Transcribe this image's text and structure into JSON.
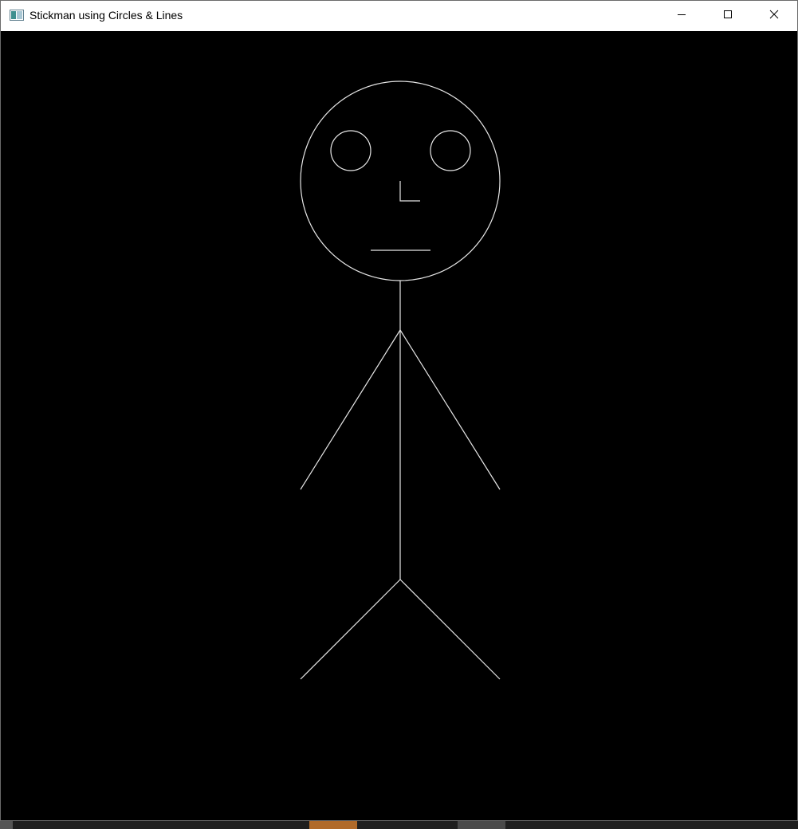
{
  "window": {
    "title": "Stickman using Circles & Lines",
    "app_icon": "app-window-icon",
    "controls": {
      "minimize_icon": "minimize-icon",
      "maximize_icon": "maximize-icon",
      "close_icon": "close-icon"
    }
  },
  "canvas": {
    "background": "#000000",
    "stroke_color": "#ffffff",
    "figure": "stickman"
  },
  "colors": {
    "titlebar": "#ffffff",
    "taskbar": "#1f1f1f",
    "taskbar_active": "#b06a2a"
  }
}
